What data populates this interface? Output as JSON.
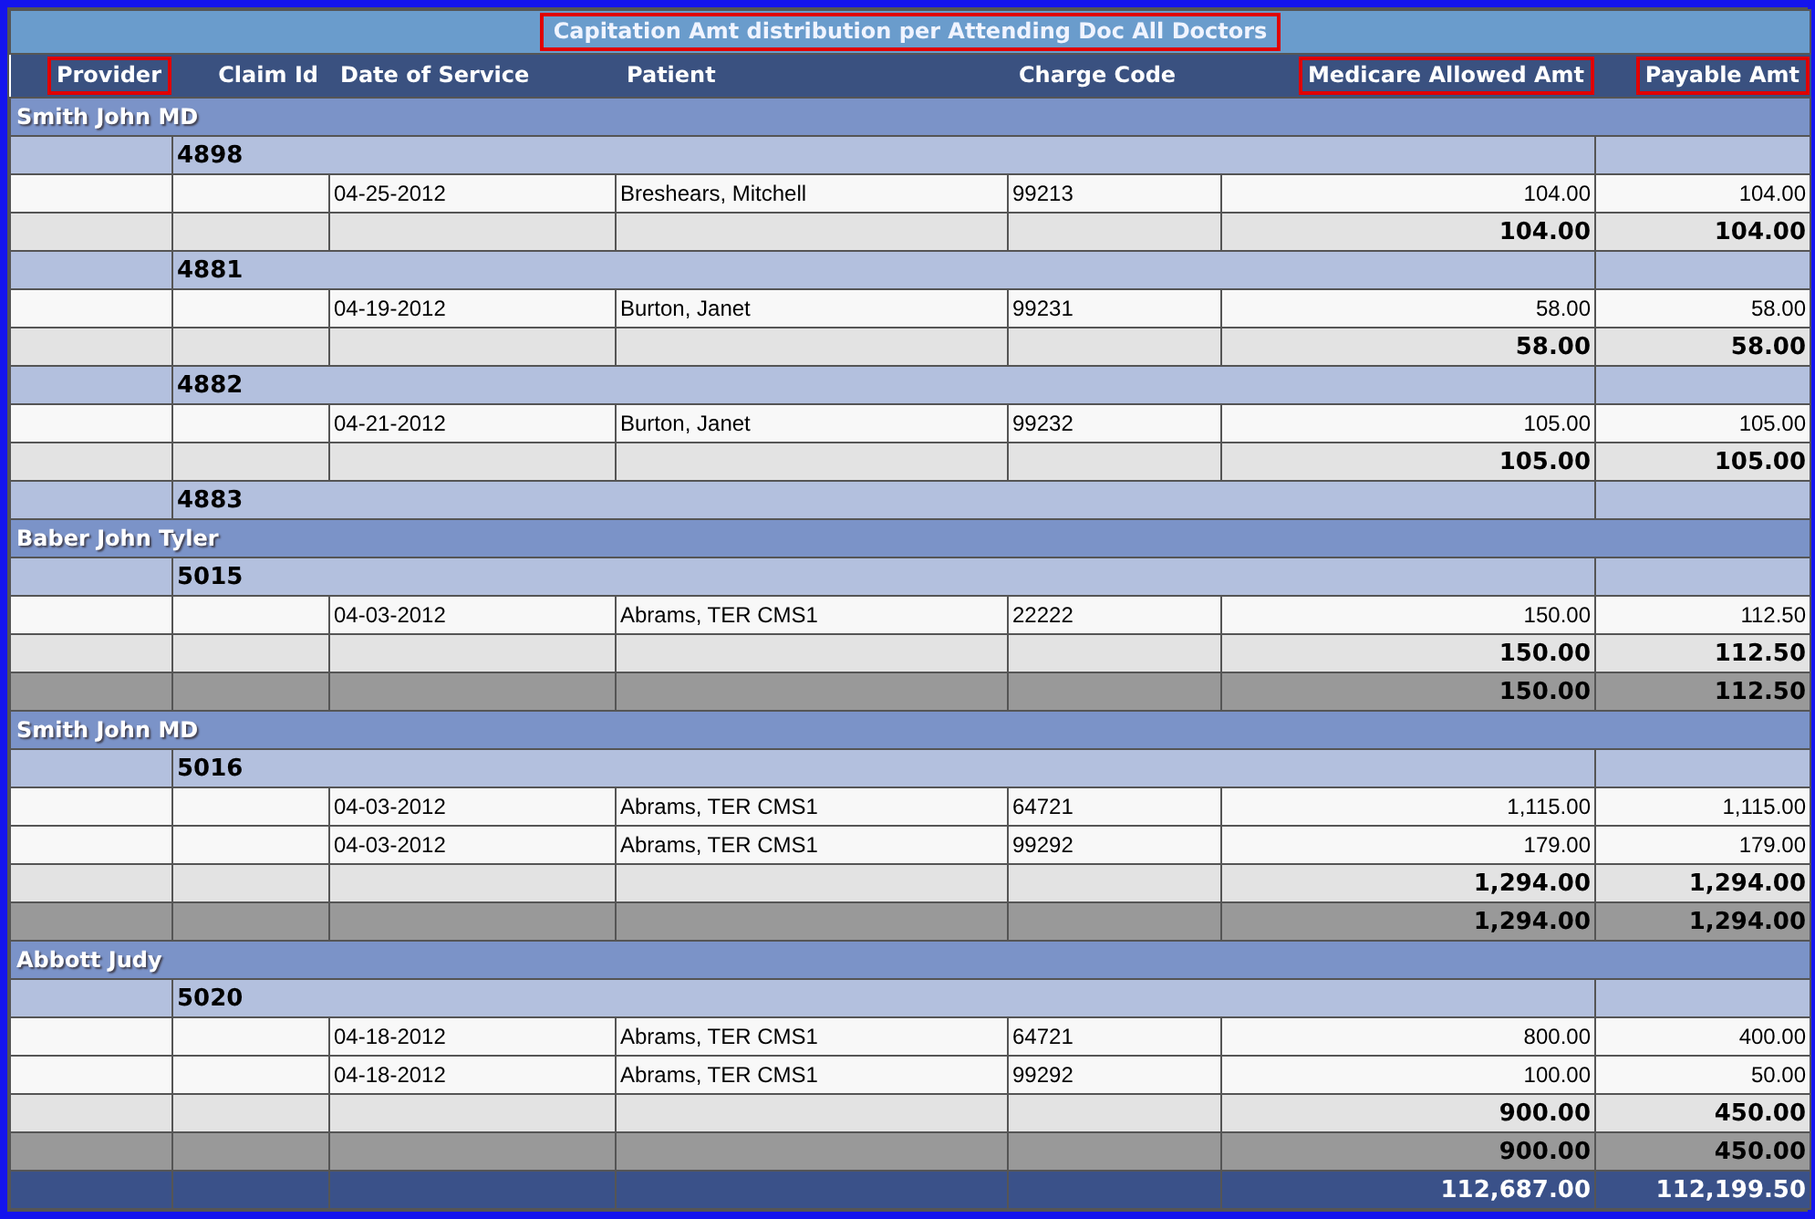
{
  "report": {
    "title": "Capitation Amt distribution per Attending Doc All Doctors",
    "title_highlighted": true
  },
  "columns": [
    {
      "label": "Provider",
      "highlighted": true
    },
    {
      "label": "Claim Id",
      "highlighted": false
    },
    {
      "label": "Date of Service",
      "highlighted": false
    },
    {
      "label": "Patient",
      "highlighted": false
    },
    {
      "label": "Charge Code",
      "highlighted": false
    },
    {
      "label": "Medicare Allowed Amt",
      "highlighted": true
    },
    {
      "label": "Payable Amt",
      "highlighted": true
    }
  ],
  "rows": [
    {
      "kind": "provider",
      "name": "Smith John MD"
    },
    {
      "kind": "claim",
      "claim_id": "4898"
    },
    {
      "kind": "line",
      "date": "04-25-2012",
      "patient": "Breshears, Mitchell",
      "code": "99213",
      "allowed": "104.00",
      "payable": "104.00"
    },
    {
      "kind": "subtotal",
      "allowed": "104.00",
      "payable": "104.00"
    },
    {
      "kind": "claim",
      "claim_id": "4881"
    },
    {
      "kind": "line",
      "date": "04-19-2012",
      "patient": "Burton, Janet",
      "code": "99231",
      "allowed": "58.00",
      "payable": "58.00"
    },
    {
      "kind": "subtotal",
      "allowed": "58.00",
      "payable": "58.00"
    },
    {
      "kind": "claim",
      "claim_id": "4882"
    },
    {
      "kind": "line",
      "date": "04-21-2012",
      "patient": "Burton, Janet",
      "code": "99232",
      "allowed": "105.00",
      "payable": "105.00"
    },
    {
      "kind": "subtotal",
      "allowed": "105.00",
      "payable": "105.00"
    },
    {
      "kind": "claim",
      "claim_id": "4883"
    },
    {
      "kind": "provider",
      "name": "Baber John Tyler"
    },
    {
      "kind": "claim",
      "claim_id": "5015"
    },
    {
      "kind": "line",
      "date": "04-03-2012",
      "patient": "Abrams, TER CMS1",
      "code": "22222",
      "allowed": "150.00",
      "payable": "112.50"
    },
    {
      "kind": "subtotal",
      "allowed": "150.00",
      "payable": "112.50"
    },
    {
      "kind": "provider_total",
      "allowed": "150.00",
      "payable": "112.50"
    },
    {
      "kind": "provider",
      "name": "Smith John MD"
    },
    {
      "kind": "claim",
      "claim_id": "5016"
    },
    {
      "kind": "line",
      "date": "04-03-2012",
      "patient": "Abrams, TER CMS1",
      "code": "64721",
      "allowed": "1,115.00",
      "payable": "1,115.00"
    },
    {
      "kind": "line",
      "date": "04-03-2012",
      "patient": "Abrams, TER CMS1",
      "code": "99292",
      "allowed": "179.00",
      "payable": "179.00"
    },
    {
      "kind": "subtotal",
      "allowed": "1,294.00",
      "payable": "1,294.00"
    },
    {
      "kind": "provider_total",
      "allowed": "1,294.00",
      "payable": "1,294.00"
    },
    {
      "kind": "provider",
      "name": "Abbott Judy"
    },
    {
      "kind": "claim",
      "claim_id": "5020"
    },
    {
      "kind": "line",
      "date": "04-18-2012",
      "patient": "Abrams, TER CMS1",
      "code": "64721",
      "allowed": "800.00",
      "payable": "400.00"
    },
    {
      "kind": "line",
      "date": "04-18-2012",
      "patient": "Abrams, TER CMS1",
      "code": "99292",
      "allowed": "100.00",
      "payable": "50.00"
    },
    {
      "kind": "subtotal",
      "allowed": "900.00",
      "payable": "450.00"
    },
    {
      "kind": "provider_total",
      "allowed": "900.00",
      "payable": "450.00"
    },
    {
      "kind": "grand_total",
      "allowed": "112,687.00",
      "payable": "112,199.50"
    }
  ]
}
